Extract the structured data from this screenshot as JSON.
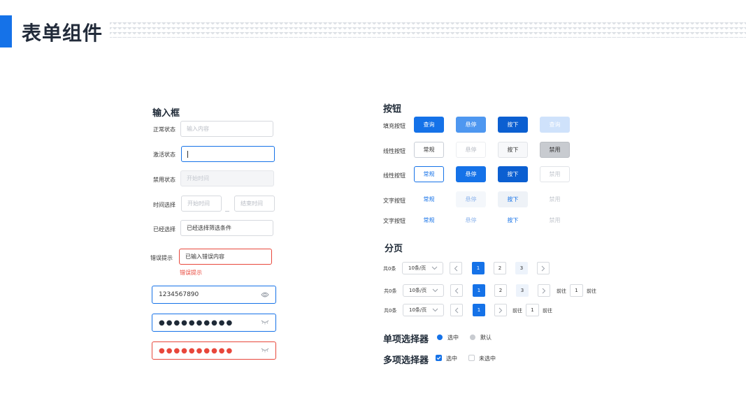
{
  "header": {
    "title": "表单组件"
  },
  "inputs": {
    "section_title": "输入框",
    "normal": {
      "label": "正常状态",
      "placeholder": "输入内容"
    },
    "active": {
      "label": "激活状态"
    },
    "disabled": {
      "label": "禁用状态",
      "placeholder": "开始时间"
    },
    "time": {
      "label": "时间选择",
      "start_placeholder": "开始时间",
      "end_placeholder": "结束时间"
    },
    "selected": {
      "label": "已经选择",
      "value": "已经选择筛选条件"
    },
    "error": {
      "label": "错误提示",
      "value": "已输入错误内容",
      "message": "错误提示"
    },
    "field_phone": {
      "value": "1234567890",
      "icon": "eye-icon"
    },
    "field_password": {
      "value": "●●●●●●●●●●",
      "icon": "eye-closed-icon"
    },
    "field_password_error": {
      "value": "●●●●●●●●●●",
      "icon": "eye-closed-icon"
    },
    "colors": {
      "active": "#1572e8",
      "error": "#e8473b",
      "error_dots": "#e8473b",
      "normal_dots": "#1f2a37"
    }
  },
  "buttons": {
    "section_title": "按钮",
    "rows": [
      {
        "label": "填充按钮",
        "buttons": [
          "查询",
          "悬停",
          "按下",
          "查询"
        ]
      },
      {
        "label": "线性按钮",
        "buttons": [
          "常规",
          "悬停",
          "按下",
          "禁用"
        ]
      },
      {
        "label": "线性按钮",
        "buttons": [
          "常规",
          "悬停",
          "按下",
          "禁用"
        ]
      },
      {
        "label": "文字按钮",
        "buttons": [
          "常规",
          "悬停",
          "按下",
          "禁用"
        ]
      },
      {
        "label": "文字按钮",
        "buttons": [
          "常规",
          "悬停",
          "按下",
          "禁用"
        ]
      }
    ],
    "colors": {
      "primary": "#1572e8"
    }
  },
  "pagination": {
    "section_title": "分页",
    "rows": [
      {
        "total": "共0条",
        "page_size": "10条/页",
        "pages": [
          "1",
          "2",
          "3"
        ]
      },
      {
        "total": "共0条",
        "page_size": "10条/页",
        "pages": [
          "1",
          "2",
          "3"
        ],
        "goto_label": "前往",
        "goto_value": "1",
        "goto_suffix": "前往"
      },
      {
        "total": "共0条",
        "page_size": "10条/页",
        "pages": [
          "1"
        ],
        "goto_label": "前往",
        "goto_value": "1",
        "goto_suffix": "前往"
      }
    ]
  },
  "radio": {
    "section_title": "单项选择器",
    "options": [
      "选中",
      "默认"
    ]
  },
  "checkbox": {
    "section_title": "多项选择器",
    "options": [
      "选中",
      "未选中"
    ]
  }
}
